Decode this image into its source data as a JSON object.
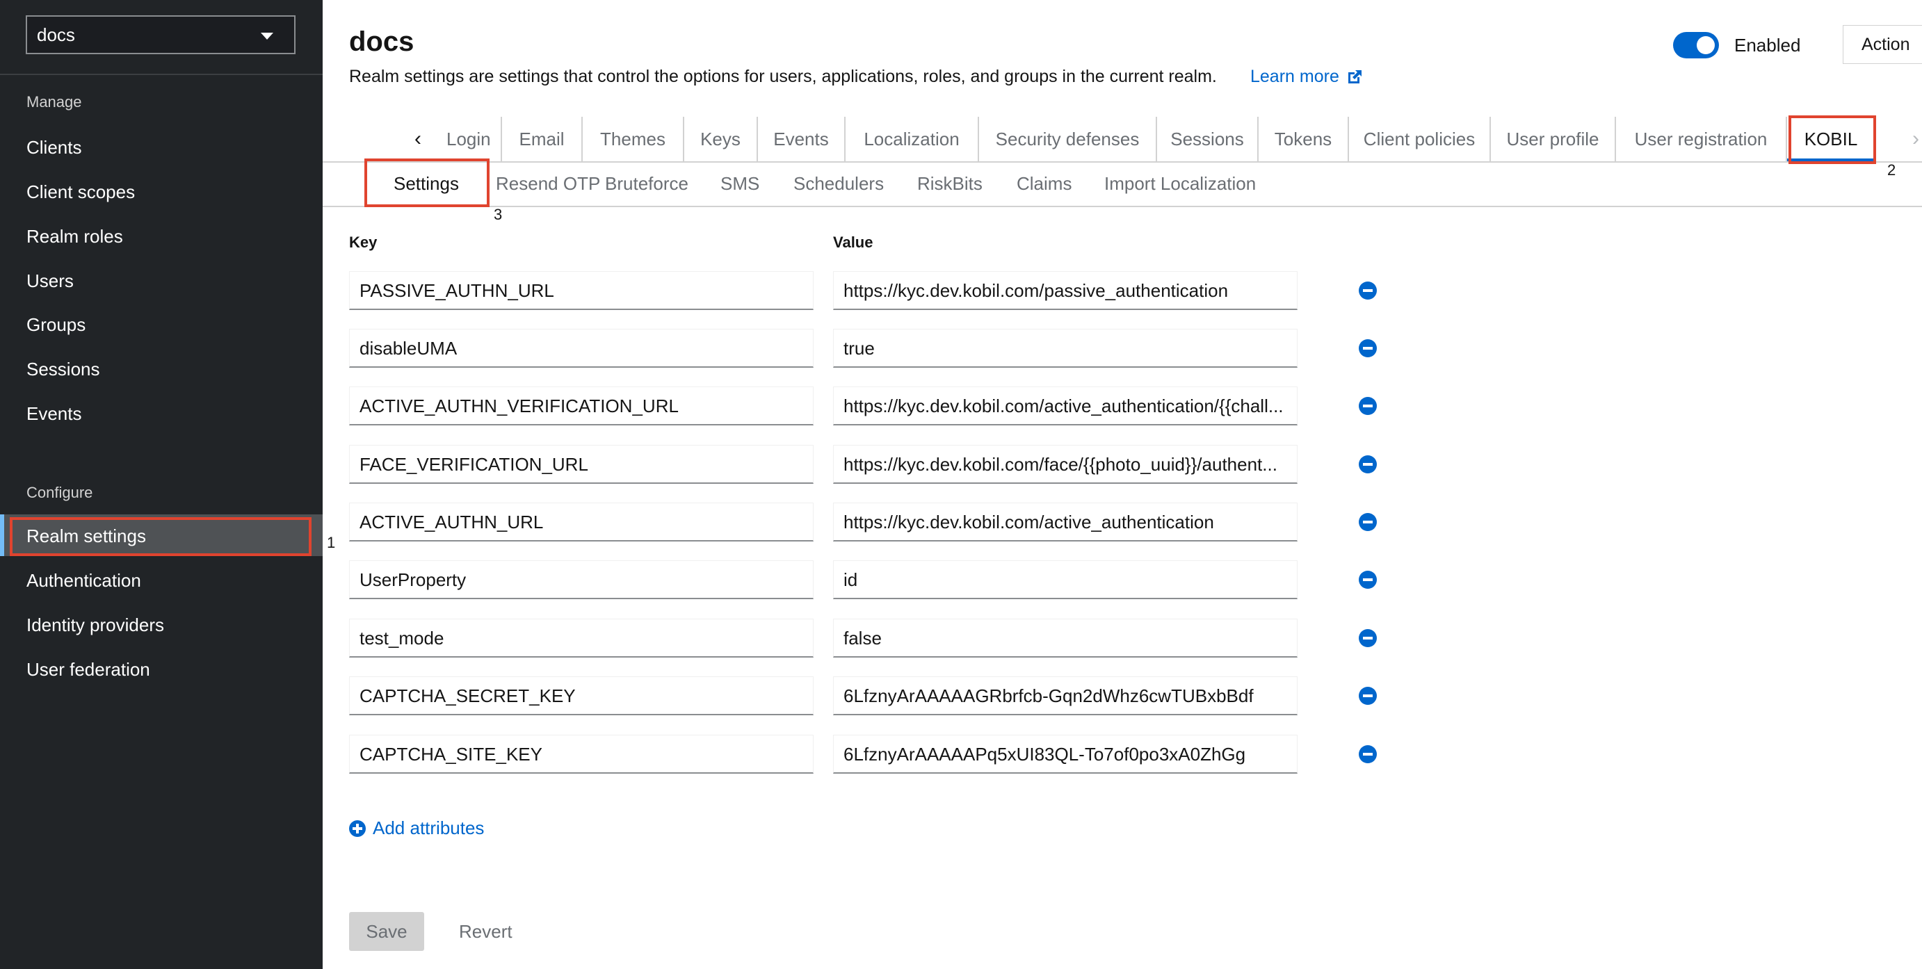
{
  "realm_selector": {
    "value": "docs"
  },
  "sidebar": {
    "manage_title": "Manage",
    "manage_items": [
      "Clients",
      "Client scopes",
      "Realm roles",
      "Users",
      "Groups",
      "Sessions",
      "Events"
    ],
    "configure_title": "Configure",
    "configure_items": [
      "Realm settings",
      "Authentication",
      "Identity providers",
      "User federation"
    ],
    "active_item": "Realm settings"
  },
  "header": {
    "title": "docs",
    "description": "Realm settings are settings that control the options for users, applications, roles, and groups in the current realm.",
    "learn_more": "Learn more",
    "enabled_label": "Enabled",
    "action_label": "Action"
  },
  "tabs": [
    "Login",
    "Email",
    "Themes",
    "Keys",
    "Events",
    "Localization",
    "Security defenses",
    "Sessions",
    "Tokens",
    "Client policies",
    "User profile",
    "User registration",
    "KOBIL"
  ],
  "active_tab": "KOBIL",
  "subtabs": [
    "Settings",
    "Resend OTP Bruteforce",
    "SMS",
    "Schedulers",
    "RiskBits",
    "Claims",
    "Import Localization"
  ],
  "active_subtab": "Settings",
  "attributes": {
    "key_header": "Key",
    "value_header": "Value",
    "rows": [
      {
        "key": "PASSIVE_AUTHN_URL",
        "value": "https://kyc.dev.kobil.com/passive_authentication"
      },
      {
        "key": "disableUMA",
        "value": "true"
      },
      {
        "key": "ACTIVE_AUTHN_VERIFICATION_URL",
        "value": "https://kyc.dev.kobil.com/active_authentication/{{chall..."
      },
      {
        "key": "FACE_VERIFICATION_URL",
        "value": "https://kyc.dev.kobil.com/face/{{photo_uuid}}/authent..."
      },
      {
        "key": "ACTIVE_AUTHN_URL",
        "value": "https://kyc.dev.kobil.com/active_authentication"
      },
      {
        "key": "UserProperty",
        "value": "id"
      },
      {
        "key": "test_mode",
        "value": "false"
      },
      {
        "key": "CAPTCHA_SECRET_KEY",
        "value": "6LfznyArAAAAAGRbrfcb-Gqn2dWhz6cwTUBxbBdf"
      },
      {
        "key": "CAPTCHA_SITE_KEY",
        "value": "6LfznyArAAAAAPq5xUI83QL-To7of0po3xA0ZhGg"
      }
    ],
    "add_label": "Add attributes"
  },
  "footer": {
    "save_label": "Save",
    "revert_label": "Revert"
  },
  "annotations": [
    "1",
    "2",
    "3"
  ],
  "colors": {
    "sidebar_bg": "#212427",
    "accent": "#0066cc",
    "highlight": "#e0442f"
  }
}
